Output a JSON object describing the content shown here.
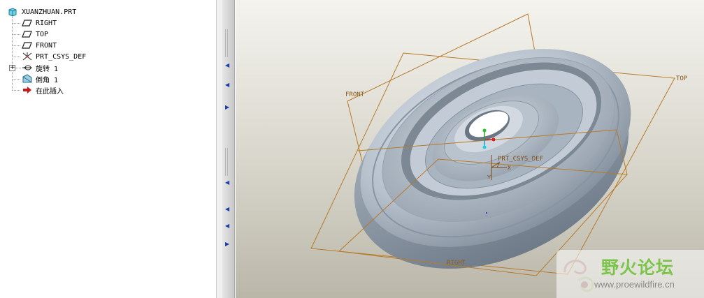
{
  "model_tree": {
    "root": {
      "label": "XUANZHUAN.PRT",
      "icon": "part-icon"
    },
    "items": [
      {
        "label": "RIGHT",
        "icon": "datum-plane-icon"
      },
      {
        "label": "TOP",
        "icon": "datum-plane-icon"
      },
      {
        "label": "FRONT",
        "icon": "datum-plane-icon"
      },
      {
        "label": "PRT_CSYS_DEF",
        "icon": "coordinate-system-icon"
      },
      {
        "label": "旋转 1",
        "icon": "revolve-feature-icon",
        "expandable": true
      },
      {
        "label": "倒角 1",
        "icon": "chamfer-feature-icon"
      },
      {
        "label": "在此插入",
        "icon": "insert-here-arrow-icon"
      }
    ]
  },
  "viewport": {
    "datum_labels": {
      "front": "FRONT",
      "top": "TOP",
      "right": "RIGHT"
    },
    "csys_label": "PRT_CSYS_DEF",
    "axis_labels": {
      "x": "X",
      "y": "Y",
      "z": "Z"
    },
    "colors": {
      "datum": "#b87a2a",
      "part_face": "#a9b6c3",
      "background_top": "#f4f3ee",
      "background_bottom": "#bab7a9"
    }
  },
  "watermark": {
    "title": "野火论坛",
    "url": "www.proewildfire.cn"
  }
}
